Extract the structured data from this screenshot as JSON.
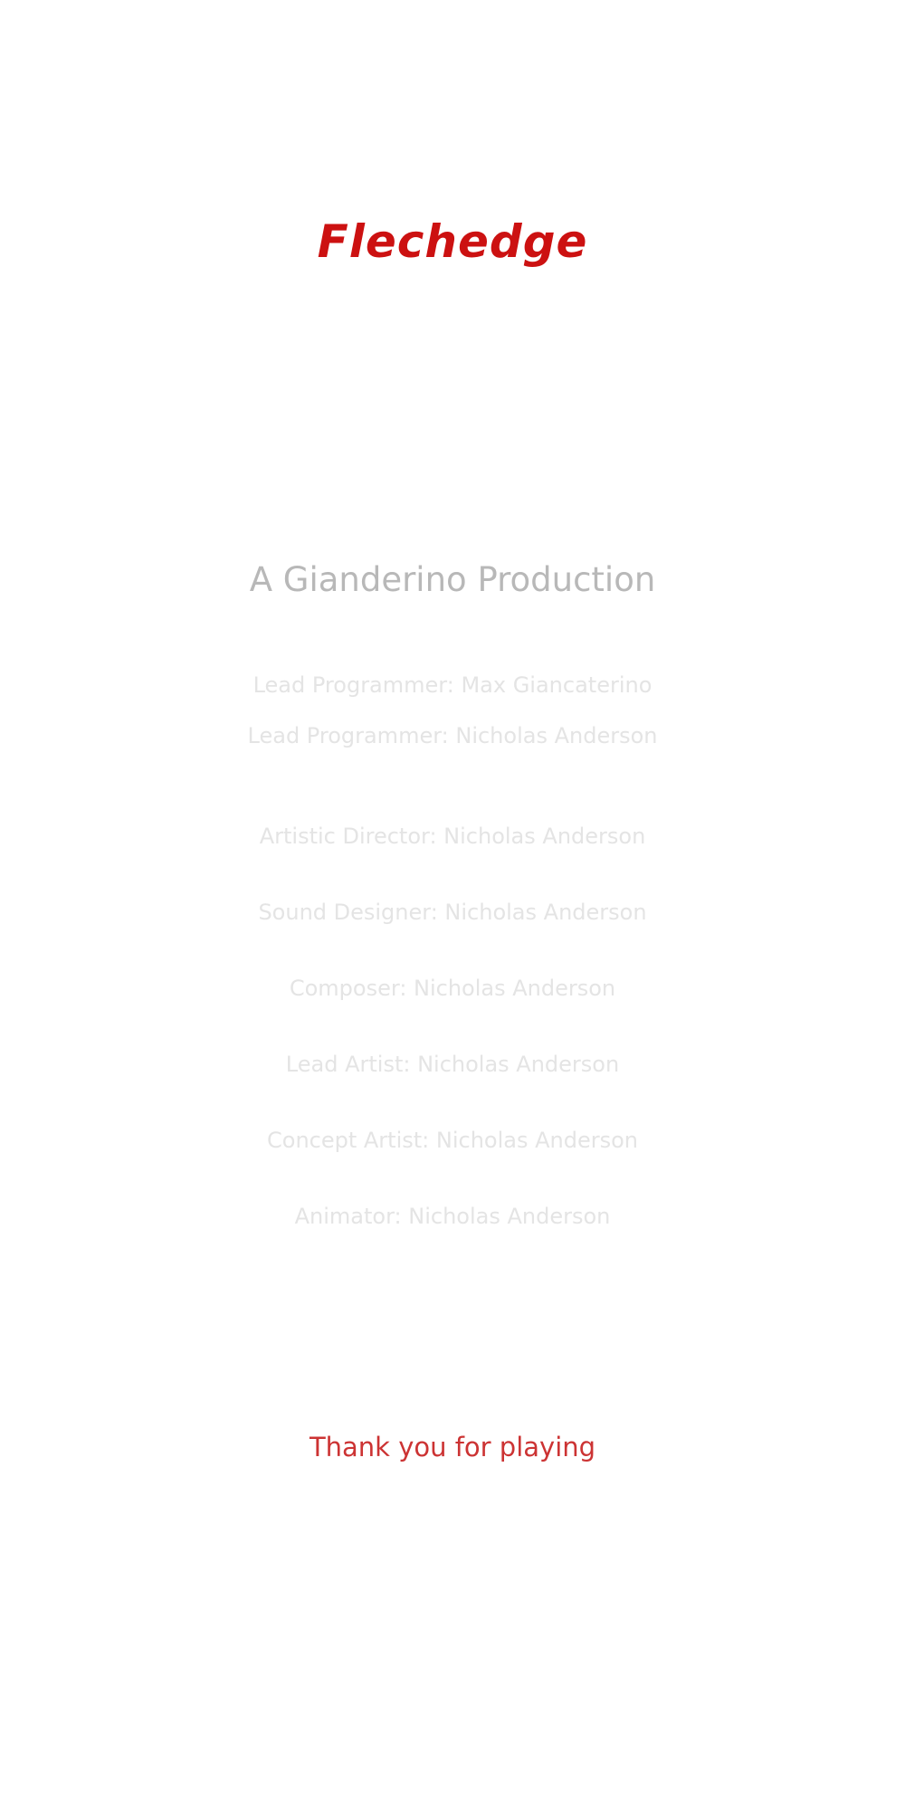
{
  "colors": {
    "title": "#cc1111",
    "studio": "#b8b8b8",
    "credits": "#e4e4e4",
    "thank_you": "#cc3333",
    "background": "#ffffff"
  },
  "title": "Flechedge",
  "studio_line": "A Gianderino Production",
  "credits": [
    "Lead Programmer: Max Giancaterino",
    "Lead Programmer: Nicholas Anderson",
    "Artistic Director: Nicholas Anderson",
    "Sound Designer: Nicholas Anderson",
    "Composer: Nicholas Anderson",
    "Lead Artist: Nicholas Anderson",
    "Concept Artist: Nicholas Anderson",
    "Animator: Nicholas Anderson"
  ],
  "thank_you": "Thank you for playing"
}
